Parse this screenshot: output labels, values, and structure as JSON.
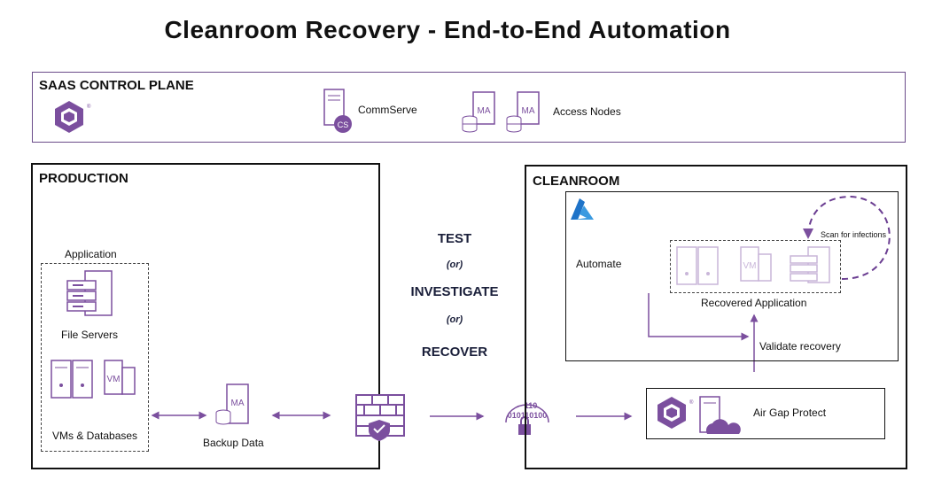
{
  "title": "Cleanroom Recovery - End-to-End Automation",
  "saas": {
    "label": "SAAS CONTROL PLANE",
    "commserve_label": "CommServe",
    "commserve_badge": "CS",
    "access_nodes_label": "Access Nodes",
    "ma_badge": "MA"
  },
  "production": {
    "label": "PRODUCTION",
    "application_label": "Application",
    "file_servers_label": "File Servers",
    "vms_label": "VMs & Databases",
    "vm_badge": "VM",
    "backup_label": "Backup Data",
    "ma_badge": "MA"
  },
  "middle": {
    "test": "TEST",
    "or1": "(or)",
    "investigate": "INVESTIGATE",
    "or2": "(or)",
    "recover": "RECOVER",
    "binary_text": "110\n010110100"
  },
  "cleanroom": {
    "label": "CLEANROOM",
    "automate_label": "Automate",
    "scan_label": "Scan for infections",
    "recovered_label": "Recovered Application",
    "validate_label": "Validate recovery",
    "airgap_label": "Air Gap Protect",
    "vm_badge": "VM"
  },
  "colors": {
    "purple": "#7b4f9e",
    "light_purple": "#c9b6d9",
    "azure_blue": "#1e73c8",
    "navy": "#1a1f3a"
  }
}
